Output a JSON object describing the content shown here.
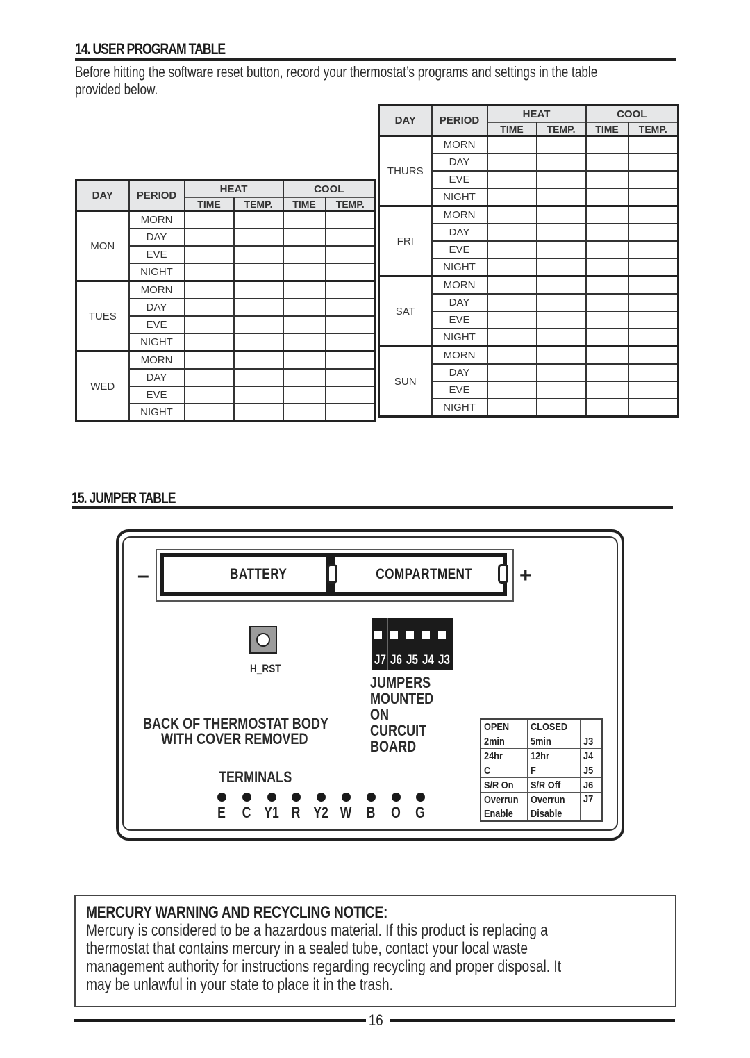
{
  "section14": {
    "title": "14. USER PROGRAM TABLE",
    "intro_line1": "Before hitting the software reset button, record your thermostat’s programs and settings in the table",
    "intro_line2": "provided below."
  },
  "program_table": {
    "headers": {
      "day": "DAY",
      "period": "PERIOD",
      "heat": "HEAT",
      "cool": "COOL",
      "time": "TIME",
      "temp": "TEMP."
    },
    "periods": [
      "MORN",
      "DAY",
      "EVE",
      "NIGHT"
    ],
    "left_days": [
      "MON",
      "TUES",
      "WED"
    ],
    "right_days": [
      "THURS",
      "FRI",
      "SAT",
      "SUN"
    ],
    "cells_blank": true
  },
  "section15": {
    "title": "15. JUMPER TABLE"
  },
  "diagram": {
    "minus": "–",
    "plus": "+",
    "battery_label": "BATTERY",
    "compartment_label": "COMPARTMENT",
    "reset_label": "H_RST",
    "jumper_ids": [
      "J7",
      "J6",
      "J5",
      "J4",
      "J3"
    ],
    "jumpers_note": [
      "JUMPERS",
      "MOUNTED",
      "ON",
      "CURCUIT",
      "BOARD"
    ],
    "body_note_line1": "BACK OF THERMOSTAT BODY",
    "body_note_line2": "WITH COVER REMOVED",
    "terminals_label": "TERMINALS",
    "terminals": [
      "E",
      "C",
      "Y1",
      "R",
      "Y2",
      "W",
      "B",
      "O",
      "G"
    ]
  },
  "jumper_table": {
    "header": {
      "open": "OPEN",
      "closed": "CLOSED",
      "jumper": ""
    },
    "rows": [
      {
        "open": "2min",
        "closed": "5min",
        "jumper": "J3"
      },
      {
        "open": "24hr",
        "closed": "12hr",
        "jumper": "J4"
      },
      {
        "open": "C",
        "closed": "F",
        "jumper": "J5"
      },
      {
        "open": "S/R On",
        "closed": "S/R Off",
        "jumper": "J6"
      },
      {
        "open": "Overrun",
        "closed": "Overrun",
        "jumper": "J7"
      },
      {
        "open": "Enable",
        "closed": "Disable",
        "jumper": ""
      }
    ]
  },
  "mercury": {
    "title": "MERCURY WARNING AND RECYCLING NOTICE:",
    "lines": [
      "Mercury is considered to be a hazardous material.  If this product is replacing a",
      "thermostat that contains mercury in a sealed tube, contact your local waste",
      "management authority for instructions regarding recycling and proper disposal.  It",
      "may be unlawful in your state to place it in the trash."
    ]
  },
  "footer": {
    "page_number": "16"
  }
}
